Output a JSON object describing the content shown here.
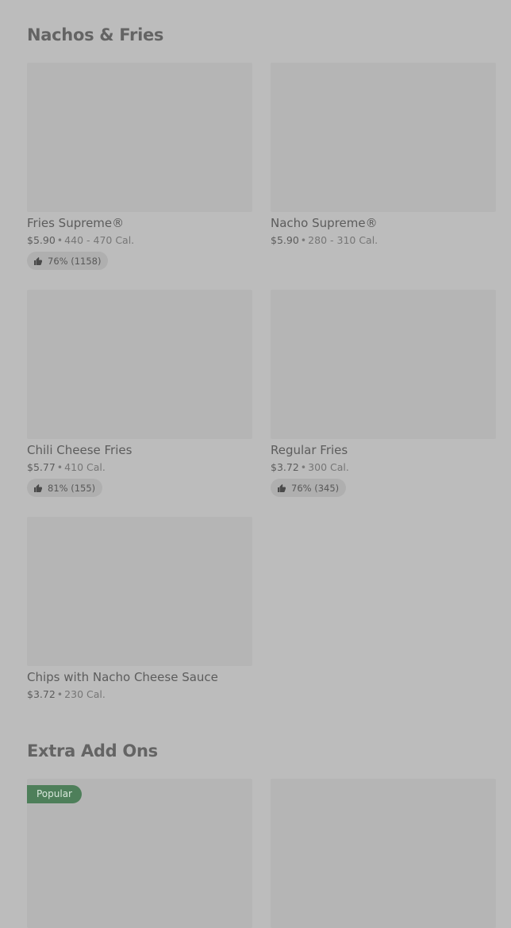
{
  "sections": [
    {
      "title": "Nachos & Fries"
    },
    {
      "title": "Extra Add Ons"
    }
  ],
  "items": [
    {
      "name": "Fries Supreme®",
      "price": "$5.90",
      "calories": "440 - 470 Cal.",
      "rating": "76% (1158)"
    },
    {
      "name": "Nacho Supreme®",
      "price": "$5.90",
      "calories": "280 - 310 Cal."
    },
    {
      "name": "Chili Cheese Fries",
      "price": "$5.77",
      "calories": "410 Cal.",
      "rating": "81% (155)"
    },
    {
      "name": "Regular Fries",
      "price": "$3.72",
      "calories": "300 Cal.",
      "rating": "76% (345)"
    },
    {
      "name": "Chips with Nacho Cheese Sauce",
      "price": "$3.72",
      "calories": "230 Cal."
    }
  ],
  "addons": [
    {
      "badge": "Popular"
    },
    {}
  ],
  "separator": "•",
  "icons": {
    "rating": "thumbs-up-icon"
  },
  "colors": {
    "badge_bg": "#4e7f5a",
    "background": "#bcbcbc"
  }
}
